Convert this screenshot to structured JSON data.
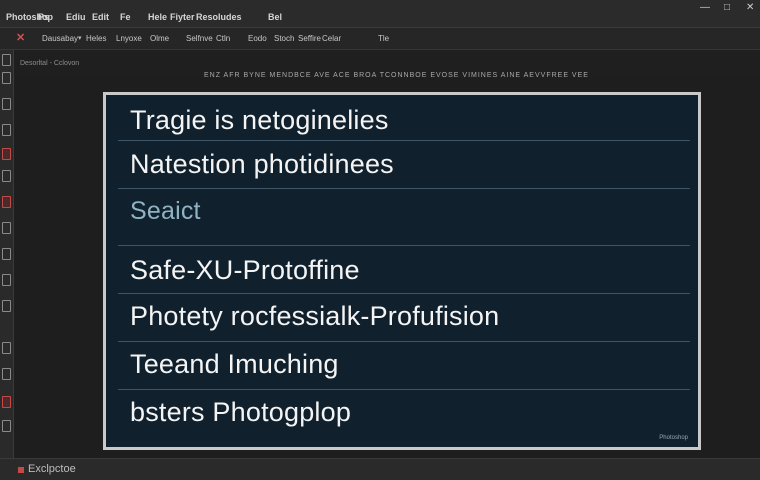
{
  "menu": {
    "items": [
      "Photoshop",
      "Ps",
      "Ediu",
      "Edit",
      "Fe",
      "Hele",
      "Fiyter",
      "Resoludes",
      "Bel"
    ]
  },
  "window_controls": {
    "minimize": "—",
    "restore": "□",
    "close": "✕"
  },
  "options": {
    "close_label": "✕",
    "items": [
      "Dausabay",
      "Heles",
      "Lnyoxe",
      "Olme",
      "Selfnve",
      "Ctln",
      "Eodo",
      "Stoch",
      "Seffire",
      "Celar",
      "Tle"
    ]
  },
  "subbar": {
    "breadcrumb": "Desorltal - Cclovon",
    "ruler_text": "ENZ AFR BYNE MENDBCE AVE ACE BROA TCONNBOE EVOSE VIMINES AINE AEVVFREE VEE"
  },
  "document": {
    "rows": [
      {
        "id": "row1",
        "text": "Tragie is netoginelies"
      },
      {
        "id": "row2",
        "text": "Natestion photidinees"
      },
      {
        "id": "row3",
        "text": "Seaict"
      },
      {
        "id": "row4",
        "text": "Safe-XU-Protoffine"
      },
      {
        "id": "row5",
        "text": "Photety rocfessialk-Profufision"
      },
      {
        "id": "row6",
        "text": "Teeand Imuching"
      },
      {
        "id": "row7",
        "text": "bsters Photogplop"
      }
    ],
    "watermark": "Photoshop"
  },
  "status": {
    "zoom_text": "Exclpctoe"
  },
  "colors": {
    "doc_bg": "#10202c",
    "frame": "#c9c9c9",
    "accent_red": "#c44a4a",
    "search_text": "#8fb3c4"
  }
}
